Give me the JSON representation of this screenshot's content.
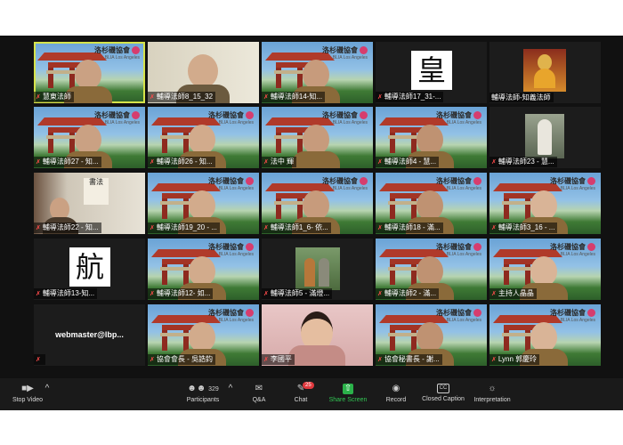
{
  "org_logo": {
    "title": "洛杉磯協會",
    "subtitle": "BLIA Los Angeles"
  },
  "tiles": [
    {
      "label": "慧東法師",
      "kind": "gate",
      "muted": true,
      "active": true
    },
    {
      "label": "輔導法師8_15_32",
      "kind": "room",
      "muted": true
    },
    {
      "label": "輔導法師14-知...",
      "kind": "gate",
      "muted": true
    },
    {
      "label": "輔導法師17_31-...",
      "kind": "glyph",
      "glyph": "皇",
      "muted": true
    },
    {
      "label": "輔導法師-知義法師",
      "kind": "altar",
      "muted": false
    },
    {
      "label": "輔導法師27 - 知...",
      "kind": "gate",
      "muted": true
    },
    {
      "label": "輔導法師26 - 知...",
      "kind": "gate",
      "muted": true
    },
    {
      "label": "法中 輝",
      "kind": "gate",
      "muted": true
    },
    {
      "label": "輔導法師4 - 慧...",
      "kind": "gate",
      "muted": true
    },
    {
      "label": "輔導法師23 - 慧...",
      "kind": "statue",
      "muted": true
    },
    {
      "label": "輔導法師22 - 知...",
      "kind": "study",
      "muted": true
    },
    {
      "label": "輔導法師19_20 - ...",
      "kind": "gate",
      "muted": true
    },
    {
      "label": "輔導法師1_6- 依...",
      "kind": "gate",
      "muted": true
    },
    {
      "label": "輔導法師18 - 滿...",
      "kind": "gate",
      "muted": true
    },
    {
      "label": "輔導法師3_16 - ...",
      "kind": "gate",
      "muted": true
    },
    {
      "label": "輔導法師13-知...",
      "kind": "glyph",
      "glyph": "航",
      "muted": true
    },
    {
      "label": "輔導法師12- 如...",
      "kind": "gate",
      "muted": true
    },
    {
      "label": "輔導法師5 - 滿燈...",
      "kind": "photo",
      "muted": true
    },
    {
      "label": "輔導法師2 - 滿...",
      "kind": "gate",
      "muted": true
    },
    {
      "label": "主持人晶晶",
      "kind": "gate",
      "muted": true
    },
    {
      "label": "",
      "kind": "name",
      "name": "webmaster@lbp...",
      "muted": true
    },
    {
      "label": "協會會長 - 吳誥鈞",
      "kind": "gate",
      "muted": true
    },
    {
      "label": "李國平",
      "kind": "pink",
      "muted": true
    },
    {
      "label": "協會秘書長 - 謝...",
      "kind": "gate",
      "muted": true
    },
    {
      "label": "Lynn 郭慶玲",
      "kind": "gate",
      "muted": true
    }
  ],
  "toolbar": {
    "stop_video": "Stop Video",
    "participants": "Participants",
    "participant_count": "329",
    "qa": "Q&A",
    "chat": "Chat",
    "chat_badge": "25",
    "share_screen": "Share Screen",
    "record": "Record",
    "closed_caption": "Closed Caption",
    "cc_icon_text": "CC",
    "interpretation": "Interpretation"
  },
  "icons": {
    "mic_muted": "muted-mic-icon",
    "stop_video": "video-camera-icon",
    "participants": "people-icon",
    "qa": "qa-bubble-icon",
    "chat": "chat-bubble-icon",
    "share": "share-arrow-icon",
    "record": "record-circle-icon",
    "cc": "closed-caption-icon",
    "interpretation": "globe-icon"
  },
  "colors": {
    "active_speaker": "#d6e34a",
    "share_green": "#31c553",
    "badge_red": "#e0393e"
  }
}
